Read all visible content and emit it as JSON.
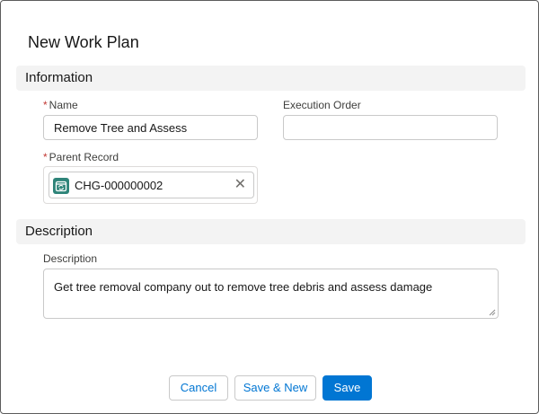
{
  "modal": {
    "title": "New Work Plan"
  },
  "sections": {
    "information": "Information",
    "description": "Description"
  },
  "fields": {
    "name": {
      "required_marker": "*",
      "label": "Name",
      "value": "Remove Tree and Assess"
    },
    "execution_order": {
      "label": "Execution Order",
      "value": ""
    },
    "parent_record": {
      "required_marker": "*",
      "label": "Parent Record",
      "value": "CHG-000000002",
      "remove_glyph": "✕"
    },
    "description": {
      "label": "Description",
      "value": "Get tree removal company out to remove tree debris and assess damage"
    }
  },
  "buttons": {
    "cancel": "Cancel",
    "save_new": "Save & New",
    "save": "Save"
  },
  "colors": {
    "brand": "#0176d3",
    "required": "#c23934",
    "record_icon": "#2e8479"
  }
}
